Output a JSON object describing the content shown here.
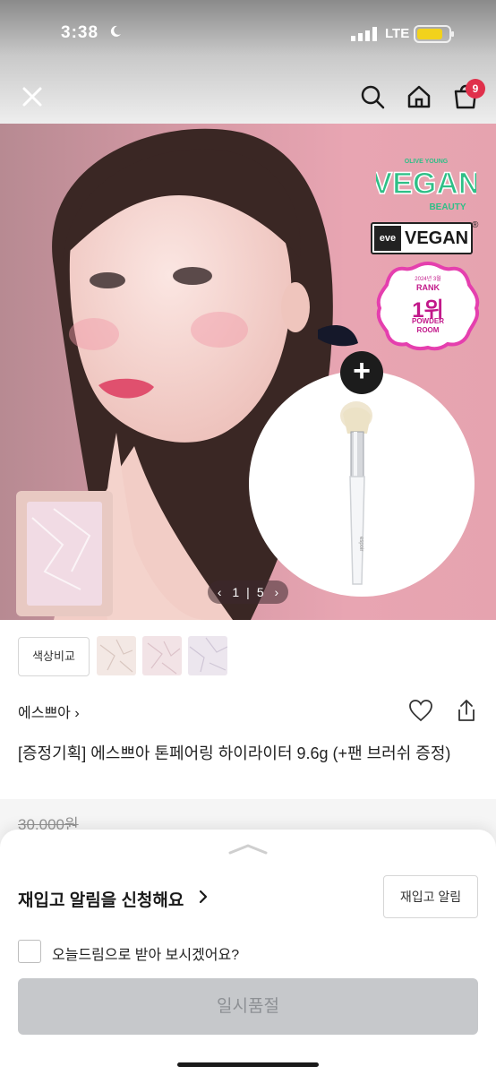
{
  "status_bar": {
    "time": "3:38",
    "network": "LTE"
  },
  "top_nav": {
    "cart_count": "9"
  },
  "hero": {
    "badges": {
      "vegan_top": "OLIVE YOUNG",
      "vegan_main": "VEGAN",
      "vegan_bottom": "BEAUTY",
      "eve_logo": "eve",
      "eve_text": "VEGAN",
      "reg": "®",
      "rank_small": "2024년 3월",
      "rank_label": "RANK",
      "rank_number": "1위",
      "rank_room_1": "POWDER",
      "rank_room_2": "ROOM"
    },
    "gift_brush_text": "espoir",
    "pager": {
      "current": "1",
      "separator": "|",
      "total": "5",
      "prev": "‹",
      "next": "›"
    }
  },
  "product": {
    "compare_label": "색상비교",
    "brand": "에스쁘아 ›",
    "title": "[증정기획] 에스쁘아 톤페어링 하이라이터 9.6g (+팬 브러쉬 증정)",
    "price": "30,000원",
    "swatch_colors": [
      "#f3e8e4",
      "#f2e3e6",
      "#ece6ee"
    ]
  },
  "bottom_sheet": {
    "restock_title": "재입고 알림을 신청해요",
    "restock_chevron": "›",
    "restock_button": "재입고 알림",
    "checkbox_label": "오늘드림으로 받아 보시겠어요?",
    "soldout_button": "일시품절"
  },
  "colors": {
    "badge_red": "#e0304b",
    "vegan_green": "#2fbf87",
    "rank_pink": "#c2188a",
    "disabled_gray": "#c6c8cb"
  },
  "icons": [
    "moon-icon",
    "signal-icon",
    "battery-icon",
    "close-icon",
    "search-icon",
    "home-icon",
    "cart-icon",
    "heart-icon",
    "share-icon",
    "chevron-up-icon"
  ]
}
